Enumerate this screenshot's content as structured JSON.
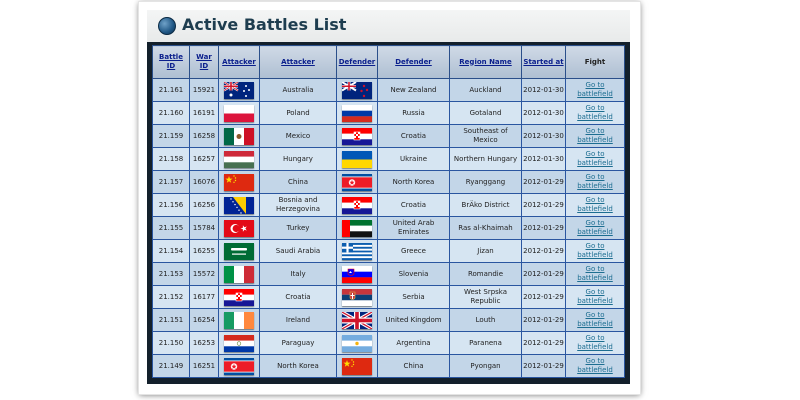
{
  "title": "Active Battles List",
  "headers": {
    "battle_id": "Battle ID",
    "war_id": "War ID",
    "attacker_flag": "Attacker",
    "attacker": "Attacker",
    "defender_flag": "Defender",
    "defender": "Defender",
    "region": "Region Name",
    "started": "Started at",
    "fight": "Fight"
  },
  "rows": [
    {
      "battle_id": "21.161",
      "war_id": "15921",
      "attacker": "Australia",
      "defender": "New Zealand",
      "region": "Auckland",
      "started": "2012-01-30",
      "fight": "Go to battlefield",
      "attacker_flag": "flag-australia",
      "defender_flag": "flag-new-zealand"
    },
    {
      "battle_id": "21.160",
      "war_id": "16191",
      "attacker": "Poland",
      "defender": "Russia",
      "region": "Gotaland",
      "started": "2012-01-30",
      "fight": "Go to battlefield",
      "attacker_flag": "flag-poland",
      "defender_flag": "flag-russia"
    },
    {
      "battle_id": "21.159",
      "war_id": "16258",
      "attacker": "Mexico",
      "defender": "Croatia",
      "region": "Southeast of Mexico",
      "started": "2012-01-30",
      "fight": "Go to battlefield",
      "attacker_flag": "flag-mexico",
      "defender_flag": "flag-croatia"
    },
    {
      "battle_id": "21.158",
      "war_id": "16257",
      "attacker": "Hungary",
      "defender": "Ukraine",
      "region": "Northern Hungary",
      "started": "2012-01-30",
      "fight": "Go to battlefield",
      "attacker_flag": "flag-hungary",
      "defender_flag": "flag-ukraine"
    },
    {
      "battle_id": "21.157",
      "war_id": "16076",
      "attacker": "China",
      "defender": "North Korea",
      "region": "Ryanggang",
      "started": "2012-01-29",
      "fight": "Go to battlefield",
      "attacker_flag": "flag-china",
      "defender_flag": "flag-north-korea"
    },
    {
      "battle_id": "21.156",
      "war_id": "16256",
      "attacker": "Bosnia and Herzegovina",
      "defender": "Croatia",
      "region": "BrÄko District",
      "started": "2012-01-29",
      "fight": "Go to battlefield",
      "attacker_flag": "flag-bosnia",
      "defender_flag": "flag-croatia"
    },
    {
      "battle_id": "21.155",
      "war_id": "15784",
      "attacker": "Turkey",
      "defender": "United Arab Emirates",
      "region": "Ras al-Khaimah",
      "started": "2012-01-29",
      "fight": "Go to battlefield",
      "attacker_flag": "flag-turkey",
      "defender_flag": "flag-uae"
    },
    {
      "battle_id": "21.154",
      "war_id": "16255",
      "attacker": "Saudi Arabia",
      "defender": "Greece",
      "region": "Jizan",
      "started": "2012-01-29",
      "fight": "Go to battlefield",
      "attacker_flag": "flag-saudi-arabia",
      "defender_flag": "flag-greece"
    },
    {
      "battle_id": "21.153",
      "war_id": "15572",
      "attacker": "Italy",
      "defender": "Slovenia",
      "region": "Romandie",
      "started": "2012-01-29",
      "fight": "Go to battlefield",
      "attacker_flag": "flag-italy",
      "defender_flag": "flag-slovenia"
    },
    {
      "battle_id": "21.152",
      "war_id": "16177",
      "attacker": "Croatia",
      "defender": "Serbia",
      "region": "West Srpska Republic",
      "started": "2012-01-29",
      "fight": "Go to battlefield",
      "attacker_flag": "flag-croatia",
      "defender_flag": "flag-serbia"
    },
    {
      "battle_id": "21.151",
      "war_id": "16254",
      "attacker": "Ireland",
      "defender": "United Kingdom",
      "region": "Louth",
      "started": "2012-01-29",
      "fight": "Go to battlefield",
      "attacker_flag": "flag-ireland",
      "defender_flag": "flag-uk"
    },
    {
      "battle_id": "21.150",
      "war_id": "16253",
      "attacker": "Paraguay",
      "defender": "Argentina",
      "region": "Paranena",
      "started": "2012-01-29",
      "fight": "Go to battlefield",
      "attacker_flag": "flag-paraguay",
      "defender_flag": "flag-argentina"
    },
    {
      "battle_id": "21.149",
      "war_id": "16251",
      "attacker": "North Korea",
      "defender": "China",
      "region": "Pyongan",
      "started": "2012-01-29",
      "fight": "Go to battlefield",
      "attacker_flag": "flag-north-korea",
      "defender_flag": "flag-china"
    }
  ]
}
